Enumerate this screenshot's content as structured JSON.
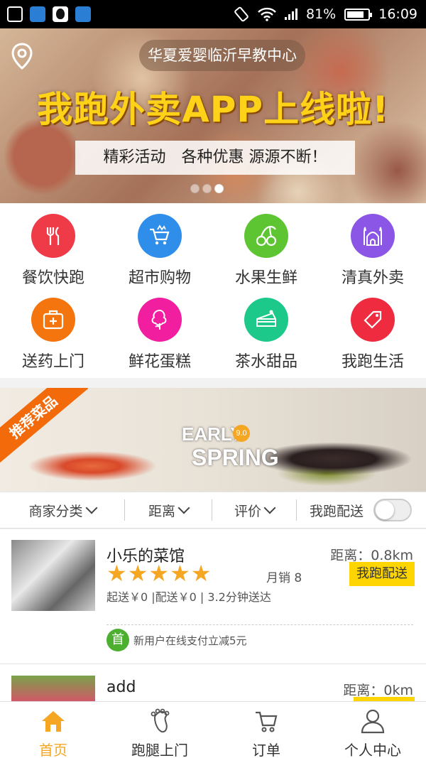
{
  "status_bar": {
    "battery": "81%",
    "time": "16:09",
    "battery_level": 0.81
  },
  "banner": {
    "store_name": "华夏爱婴临沂早教中心",
    "headline": "我跑外卖APP上线啦!",
    "subline": "精彩活动　各种优惠  源源不断！",
    "page_count": 3,
    "active_page": 3
  },
  "categories": [
    {
      "label": "餐饮快跑",
      "color": "#ef3a47",
      "icon": "fork-knife-icon"
    },
    {
      "label": "超市购物",
      "color": "#2f8ee9",
      "icon": "shopping-cart-icon"
    },
    {
      "label": "水果生鲜",
      "color": "#5cc531",
      "icon": "cherry-icon"
    },
    {
      "label": "清真外卖",
      "color": "#8b55e6",
      "icon": "mosque-icon"
    },
    {
      "label": "送药上门",
      "color": "#f4740d",
      "icon": "medicine-kit-icon"
    },
    {
      "label": "鲜花蛋糕",
      "color": "#f11fa0",
      "icon": "flower-icon"
    },
    {
      "label": "茶水甜品",
      "color": "#1cc98a",
      "icon": "cake-icon"
    },
    {
      "label": "我跑生活",
      "color": "#ef2b3f",
      "icon": "tag-icon"
    }
  ],
  "promo": {
    "ribbon": "推荐菜品",
    "text_top": "EARLY",
    "text_bottom": "SPRING",
    "badge": "9.0"
  },
  "filters": {
    "category": "商家分类",
    "distance": "距离",
    "rating": "评价",
    "self_delivery": "我跑配送",
    "self_delivery_on": false
  },
  "shops": [
    {
      "name": "小乐的菜馆",
      "distance": "距离：0.8km",
      "rating": 5,
      "sales": "月销 8",
      "delivery_tag": "我跑配送",
      "meta": "起送￥0 |配送￥0 | 3.2分钟送达",
      "promo_badge": "首",
      "promo_text": "新用户在线支付立减5元"
    },
    {
      "name": "add",
      "distance": "距离：0km",
      "delivery_tag": ""
    }
  ],
  "bottom_nav": [
    {
      "label": "首页",
      "icon": "home-icon",
      "active": true
    },
    {
      "label": "跑腿上门",
      "icon": "footprint-icon",
      "active": false
    },
    {
      "label": "订单",
      "icon": "cart-icon",
      "active": false
    },
    {
      "label": "个人中心",
      "icon": "user-icon",
      "active": false
    }
  ],
  "colors": {
    "accent": "#f5a623",
    "tag_yellow": "#ffd500",
    "headline_yellow": "#ffd21a"
  }
}
